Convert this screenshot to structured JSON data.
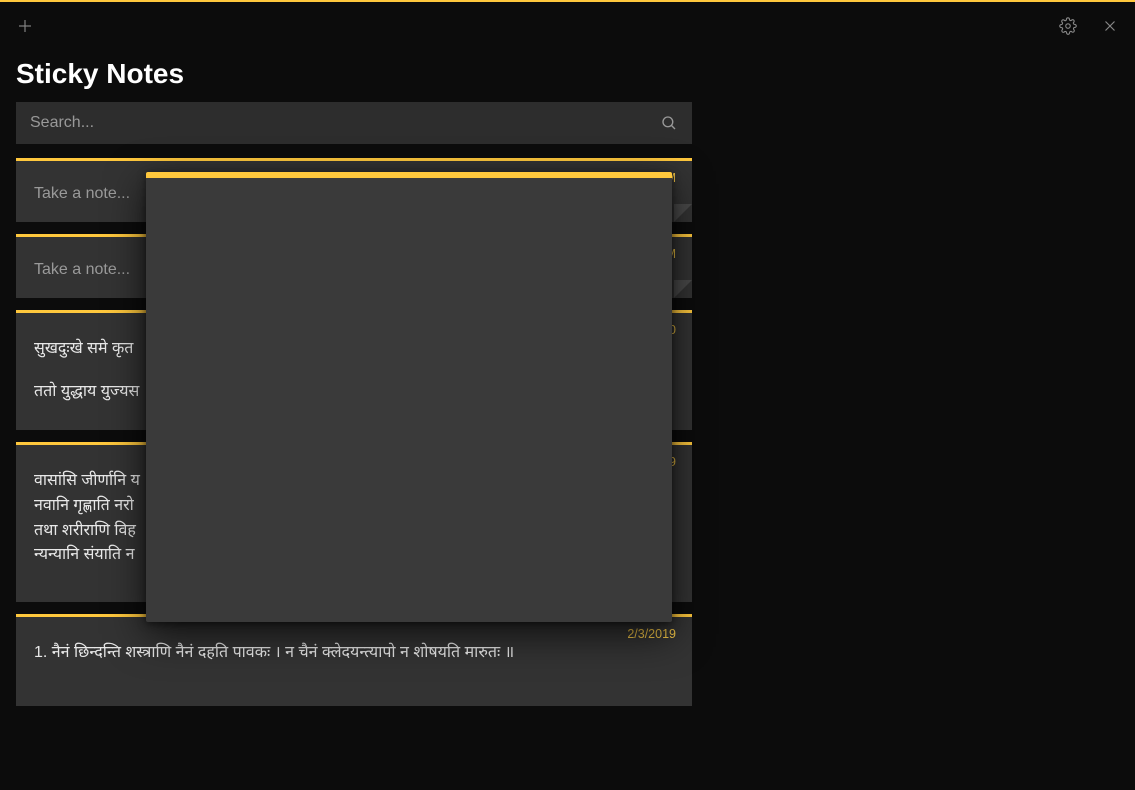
{
  "app": {
    "title": "Sticky Notes"
  },
  "search": {
    "placeholder": "Search..."
  },
  "notes": [
    {
      "date": "5 PM",
      "placeholder": "Take a note...",
      "lines": [],
      "dogear": true
    },
    {
      "date": "4 PM",
      "placeholder": "Take a note...",
      "lines": [],
      "dogear": true
    },
    {
      "date": "2020",
      "placeholder": "",
      "lines": [
        "सुखदुःखे समे कृत",
        "",
        "ततो युद्धाय युज्यस"
      ],
      "dogear": false
    },
    {
      "date": "2019",
      "placeholder": "",
      "lines": [
        "वासांसि जीर्णानि य",
        "नवानि गृह्णाति नरो",
        "तथा शरीराणि विह",
        "न्यन्यानि संयाति न"
      ],
      "dogear": false
    },
    {
      "date": "2/3/2019",
      "placeholder": "",
      "lines": [
        "1. नैनं छिन्दन्ति शस्त्राणि नैनं दहति पावकः । न चैनं क्लेदयन्त्यापो न शोषयति मारुतः ॥"
      ],
      "dogear": false
    }
  ],
  "colors": {
    "accent": "#ffc83d",
    "background": "#0c0c0c",
    "card": "#333333"
  },
  "icons": {
    "plus": "plus-icon",
    "settings": "gear-icon",
    "close": "close-icon",
    "search": "search-icon"
  }
}
